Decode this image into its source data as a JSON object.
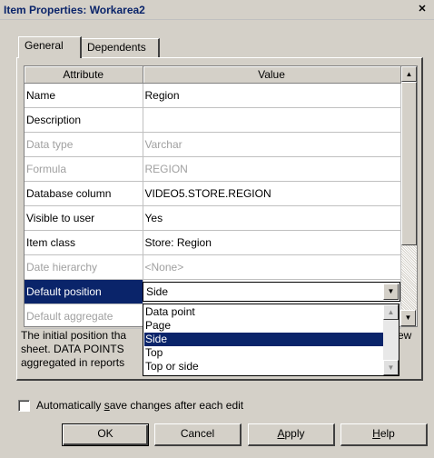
{
  "window": {
    "title": "Item Properties: Workarea2",
    "close_label": "✕"
  },
  "tabs": [
    {
      "label": "General"
    },
    {
      "label": "Dependents"
    }
  ],
  "grid": {
    "headers": {
      "attribute": "Attribute",
      "value": "Value"
    },
    "rows": [
      {
        "attribute": "Name",
        "value": "Region"
      },
      {
        "attribute": "Description",
        "value": ""
      },
      {
        "attribute": "Data type",
        "value": "Varchar"
      },
      {
        "attribute": "Formula",
        "value": "REGION"
      },
      {
        "attribute": "Database column",
        "value": "VIDEO5.STORE.REGION"
      },
      {
        "attribute": "Visible to user",
        "value": "Yes"
      },
      {
        "attribute": "Item class",
        "value": "Store: Region"
      },
      {
        "attribute": "Date hierarchy",
        "value": "<None>"
      },
      {
        "attribute": "Default position",
        "value": "Side"
      },
      {
        "attribute": "Default aggregate",
        "value": ""
      }
    ]
  },
  "dropdown": {
    "selected": "Side",
    "options": [
      "Data point",
      "Page",
      "Side",
      "Top",
      "Top or side"
    ]
  },
  "description": {
    "line1_left": "The initial position tha",
    "line1_right": "ew",
    "line2": "sheet. DATA POINTS",
    "line3": "aggregated in reports"
  },
  "autosave": {
    "label_pre": "Automatically ",
    "label_accel": "s",
    "label_post": "ave changes after each edit",
    "checked": false
  },
  "buttons": {
    "ok": "OK",
    "cancel": "Cancel",
    "apply_accel": "A",
    "apply_rest": "pply",
    "help_accel": "H",
    "help_rest": "elp"
  }
}
